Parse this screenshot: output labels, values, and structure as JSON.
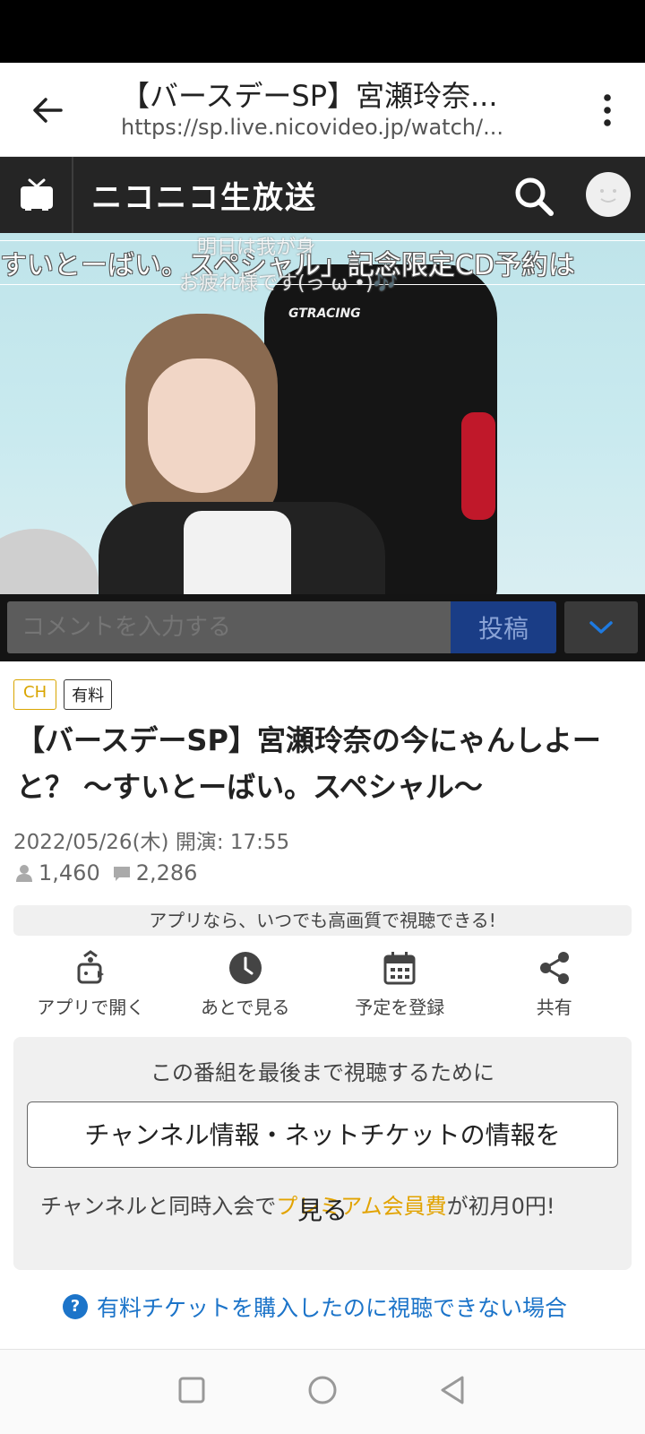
{
  "browser": {
    "title": "【バースデーSP】宮瀬玲奈...",
    "url": "https://sp.live.nicovideo.jp/watch/..."
  },
  "site_header": {
    "logo_text": "ニコニコ生放送"
  },
  "video": {
    "scrolling_comment": "すいとーばい。スペシャル」記念限定CD予約は",
    "overlay_comments": [
      "明日は我が身",
      "お疲れ様です(っ ω •)🎶"
    ],
    "chair_brand": "GTRACING"
  },
  "comment_bar": {
    "placeholder": "コメントを入力する",
    "post_label": "投稿"
  },
  "program": {
    "badge_ch": "CH",
    "badge_paid": "有料",
    "title": "【バースデーSP】宮瀬玲奈の今にゃんしよーと？ 〜すいとーばい。スペシャル〜",
    "date": "2022/05/26(木) 開演: 17:55",
    "viewers": "1,460",
    "comments": "2,286"
  },
  "app_banner": "アプリなら、いつでも高画質で視聴できる!",
  "actions": [
    {
      "label": "アプリで開く",
      "icon": "app-open-icon"
    },
    {
      "label": "あとで見る",
      "icon": "clock-icon"
    },
    {
      "label": "予定を登録",
      "icon": "calendar-icon"
    },
    {
      "label": "共有",
      "icon": "share-icon"
    }
  ],
  "purchase": {
    "heading": "この番組を最後まで視聴するために",
    "channel_button": "チャンネル情報・ネットチケットの情報を",
    "channel_button_overflow": "見る",
    "note_before": "チャンネルと同時入会で",
    "note_highlight": "プレミアム会員費",
    "note_after": "が初月0円!"
  },
  "help_link": "有料チケットを購入したのに視聴できない場合",
  "colors": {
    "header_bg": "#252525",
    "post_button": "#1a3d86",
    "ch_badge": "#d9a500",
    "link": "#1c74c9",
    "highlight": "#e2a300"
  }
}
